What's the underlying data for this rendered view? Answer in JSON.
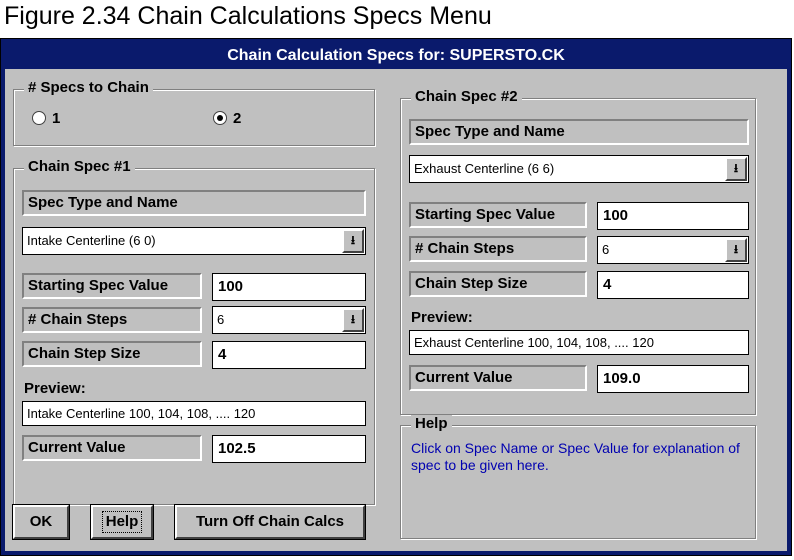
{
  "caption": "Figure 2.34  Chain Calculations Specs Menu",
  "window": {
    "title": "Chain Calculation Specs for: SUPERSTO.CK"
  },
  "specs_to_chain": {
    "title": "# Specs to Chain",
    "options": [
      "1",
      "2"
    ],
    "selected": "2"
  },
  "chain_spec_1": {
    "title": "Chain Spec #1",
    "type_label": "Spec Type and Name",
    "spec_select": "Intake Centerline (6 0)",
    "starting_label": "Starting Spec Value",
    "starting_value": "100",
    "steps_label": "# Chain Steps",
    "steps_value": "6",
    "step_size_label": "Chain Step Size",
    "step_size_value": "4",
    "preview_label": "Preview:",
    "preview_value": "Intake Centerline  100, 104, 108, .... 120",
    "current_label": "Current Value",
    "current_value": "102.5"
  },
  "chain_spec_2": {
    "title": "Chain Spec #2",
    "type_label": "Spec Type and Name",
    "spec_select": "Exhaust Centerline (6 6)",
    "starting_label": "Starting Spec Value",
    "starting_value": "100",
    "steps_label": "# Chain Steps",
    "steps_value": "6",
    "step_size_label": "Chain Step Size",
    "step_size_value": "4",
    "preview_label": "Preview:",
    "preview_value": "Exhaust Centerline  100, 104, 108, .... 120",
    "current_label": "Current Value",
    "current_value": "109.0"
  },
  "help": {
    "title": "Help",
    "text": "Click on Spec Name or Spec Value for explanation of spec to be given here."
  },
  "buttons": {
    "ok": "OK",
    "help": "Help",
    "turn_off": "Turn Off Chain Calcs"
  },
  "icons": {
    "dropdown": "dropdown-arrow-icon",
    "dropdown_glyph": "⭳"
  },
  "colors": {
    "titlebar": "#0a1a6c",
    "dialog": "#c0c0c0",
    "help_text": "#0000b0"
  }
}
